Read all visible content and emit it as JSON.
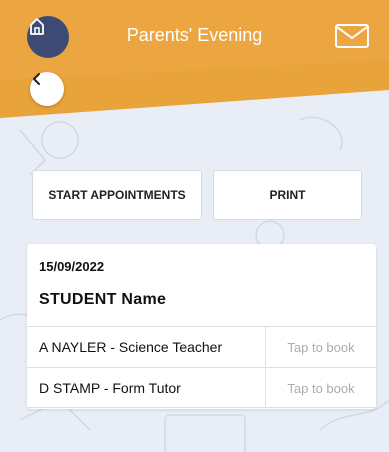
{
  "header": {
    "title": "Parents' Evening",
    "color": "#e8a33a",
    "icons": {
      "home": "home-icon",
      "mail": "mail-icon",
      "back": "chevron-left-icon"
    }
  },
  "actions": {
    "start_label": "START APPOINTMENTS",
    "print_label": "PRINT"
  },
  "card": {
    "date": "15/09/2022",
    "student": "STUDENT Name",
    "rows": [
      {
        "teacher": "A NAYLER - Science Teacher",
        "action": "Tap to book"
      },
      {
        "teacher": "D STAMP - Form Tutor",
        "action": "Tap to book"
      }
    ]
  }
}
